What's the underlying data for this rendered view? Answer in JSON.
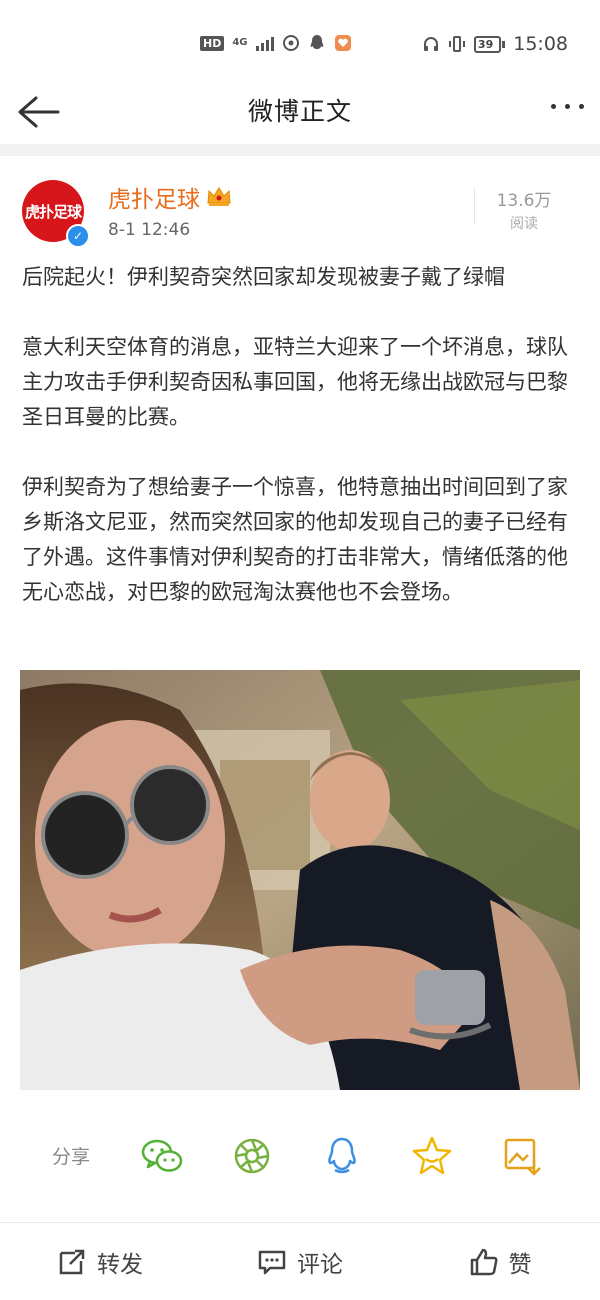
{
  "status_bar": {
    "hd_label": "HD",
    "network_label": "4G",
    "battery_level": "39",
    "time": "15:08"
  },
  "nav": {
    "title": "微博正文"
  },
  "post": {
    "avatar_text": "虎扑足球",
    "author": "虎扑足球",
    "timestamp": "8-1 12:46",
    "reads_count": "13.6万",
    "reads_label": "阅读",
    "paragraphs": [
      "后院起火！伊利契奇突然回家却发现被妻子戴了绿帽",
      "意大利天空体育的消息，亚特兰大迎来了一个坏消息，球队主力攻击手伊利契奇因私事回国，他将无缘出战欧冠与巴黎圣日耳曼的比赛。",
      "伊利契奇为了想给妻子一个惊喜，他特意抽出时间回到了家乡斯洛文尼亚，然而突然回家的他却发现自己的妻子已经有了外遇。这件事情对伊利契奇的打击非常大，情绪低落的他无心恋战，对巴黎的欧冠淘汰赛他也不会登场。"
    ]
  },
  "share": {
    "label": "分享",
    "targets": [
      "wechat-icon",
      "moments-icon",
      "qq-icon",
      "favorites-icon",
      "save-image-icon"
    ]
  },
  "actions": {
    "repost": "转发",
    "comment": "评论",
    "like": "赞"
  },
  "colors": {
    "accent_orange": "#e86c1a",
    "wechat_green": "#53b234",
    "qq_blue": "#3d8fe0",
    "star_yellow": "#f2b600",
    "brand_red": "#d7161b"
  }
}
